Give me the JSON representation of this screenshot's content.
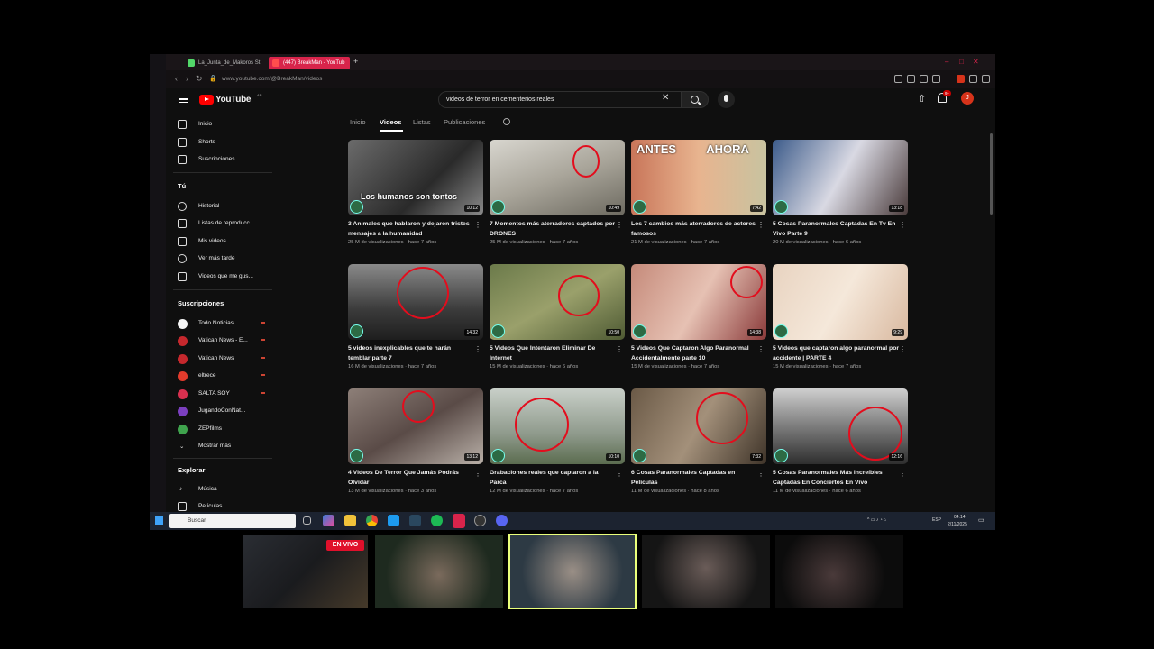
{
  "browser": {
    "tabs": [
      {
        "label": "La_Junta_de_Makoros St",
        "favicon_color": "#53d86a"
      },
      {
        "label": "(447) BreakMan - YouTub",
        "favicon_color": "#ff4d4d"
      }
    ],
    "url": "www.youtube.com/@BreakMan/videos"
  },
  "youtube": {
    "logo_text": "YouTube",
    "country_code": "AR",
    "search_value": "videos de terror en cementerios reales",
    "notification_count": "9+",
    "avatar_letter": "J"
  },
  "guide": {
    "main": [
      {
        "label": "Inicio",
        "icon": "home-icon"
      },
      {
        "label": "Shorts",
        "icon": "shorts-icon"
      },
      {
        "label": "Suscripciones",
        "icon": "subscriptions-icon"
      }
    ],
    "you_header": "Tú",
    "you": [
      {
        "label": "Historial",
        "icon": "history-icon"
      },
      {
        "label": "Listas de reproducc...",
        "icon": "playlist-icon"
      },
      {
        "label": "Mis videos",
        "icon": "my-videos-icon"
      },
      {
        "label": "Ver más tarde",
        "icon": "watch-later-icon"
      },
      {
        "label": "Videos que me gus...",
        "icon": "like-icon"
      }
    ],
    "subs_header": "Suscripciones",
    "subs": [
      {
        "label": "Todo Noticias",
        "color": "#f5f5f5"
      },
      {
        "label": "Vatican News - E...",
        "color": "#c6282d"
      },
      {
        "label": "Vatican News",
        "color": "#c6282d"
      },
      {
        "label": "eltrece",
        "color": "#e23b2c"
      },
      {
        "label": "SALTA SOY",
        "color": "#d9304f"
      },
      {
        "label": "JugandoConNat...",
        "color": "#7b3fbf"
      },
      {
        "label": "ZEPfilms",
        "color": "#3fa34d"
      }
    ],
    "show_more": "Mostrar más",
    "explore_header": "Explorar",
    "explore": [
      {
        "label": "Música",
        "icon": "music-icon"
      },
      {
        "label": "Películas",
        "icon": "movies-icon"
      }
    ]
  },
  "channel_tabs": [
    "Inicio",
    "Videos",
    "Listas",
    "Publicaciones"
  ],
  "videos": [
    {
      "title": "3 Animales que hablaron y dejaron tristes mensajes a la humanidad",
      "meta": "25 M de visualizaciones · hace 7 años",
      "duration": "10:12",
      "caption": "Los humanos son tontos",
      "bg": "linear-gradient(135deg,#6b6b6b,#2a2a2a 60%,#8a8a8a)"
    },
    {
      "title": "7 Momentos más aterradores captados por DRONES",
      "meta": "25 M de visualizaciones · hace 7 años",
      "duration": "10:49",
      "caption": "",
      "bg": "linear-gradient(160deg,#d8d6cf,#a9a59a 50%,#6d6a60)"
    },
    {
      "title": "Los 7 cambios más aterradores de actores famosos",
      "meta": "21 M de visualizaciones · hace 7 años",
      "duration": "7:42",
      "caption": "ANTES AHORA",
      "bg": "linear-gradient(90deg,#c9765a,#e8b48f 50%,#c8c3a0)"
    },
    {
      "title": "5 Cosas Paranormales Captadas En Tv En Vivo Parte 9",
      "meta": "20 M de visualizaciones · hace 6 años",
      "duration": "13:18",
      "caption": "",
      "bg": "linear-gradient(120deg,#3c5b8a,#d9d9e3 50%,#4a3b3b)"
    },
    {
      "title": "5 videos inexplicables que te harán temblar parte 7",
      "meta": "16 M de visualizaciones · hace 7 años",
      "duration": "14:32",
      "caption": "",
      "bg": "linear-gradient(180deg,#8a8a8a,#3b3b3b 60%,#1e1e1e)"
    },
    {
      "title": "5 Videos Que Intentaron Eliminar De Internet",
      "meta": "15 M de visualizaciones · hace 6 años",
      "duration": "10:50",
      "caption": "",
      "bg": "linear-gradient(150deg,#6b7a4a,#9aa06b 50%,#4e5a33)"
    },
    {
      "title": "5 Videos Que Captaron Algo Paranormal Accidentalmente parte 10",
      "meta": "15 M de visualizaciones · hace 7 años",
      "duration": "14:38",
      "caption": "",
      "bg": "linear-gradient(120deg,#c58a7a,#e6c1b3 50%,#8a3a3a)"
    },
    {
      "title": "5 Videos que captaron algo paranormal por accidente | PARTE 4",
      "meta": "15 M de visualizaciones · hace 7 años",
      "duration": "9:29",
      "caption": "",
      "bg": "linear-gradient(120deg,#e8d3c0,#f5e8da 50%,#d9b9a0)"
    },
    {
      "title": "4 Videos De Terror Que Jamás Podrás Olvidar",
      "meta": "13 M de visualizaciones · hace 3 años",
      "duration": "13:12",
      "caption": "",
      "bg": "linear-gradient(150deg,#8d7f78,#5a4b47 50%,#b9b0a8)"
    },
    {
      "title": "Grabaciones reales que captaron a la Parca",
      "meta": "12 M de visualizaciones · hace 7 años",
      "duration": "10:10",
      "caption": "",
      "bg": "linear-gradient(180deg,#c8cfc8,#8f9a8c 60%,#5b6c4f)"
    },
    {
      "title": "6 Cosas Paranormales Captadas en Películas",
      "meta": "11 M de visualizaciones · hace 8 años",
      "duration": "7:32",
      "caption": "",
      "bg": "linear-gradient(120deg,#6b5a47,#a3907a 50%,#3f3429)"
    },
    {
      "title": "5 Cosas Paranormales Más Increíbles Captadas En Conciertos En Vivo",
      "meta": "11 M de visualizaciones · hace 6 años",
      "duration": "12:16",
      "caption": "",
      "bg": "linear-gradient(180deg,#cfcfcf,#7c7c7c 50%,#2e2e2e)"
    }
  ],
  "taskbar": {
    "search_placeholder": "Buscar",
    "lang": "ESP",
    "time": "04:14",
    "date": "2/11/2025"
  },
  "stream": {
    "live_label": "EN VIVO"
  }
}
